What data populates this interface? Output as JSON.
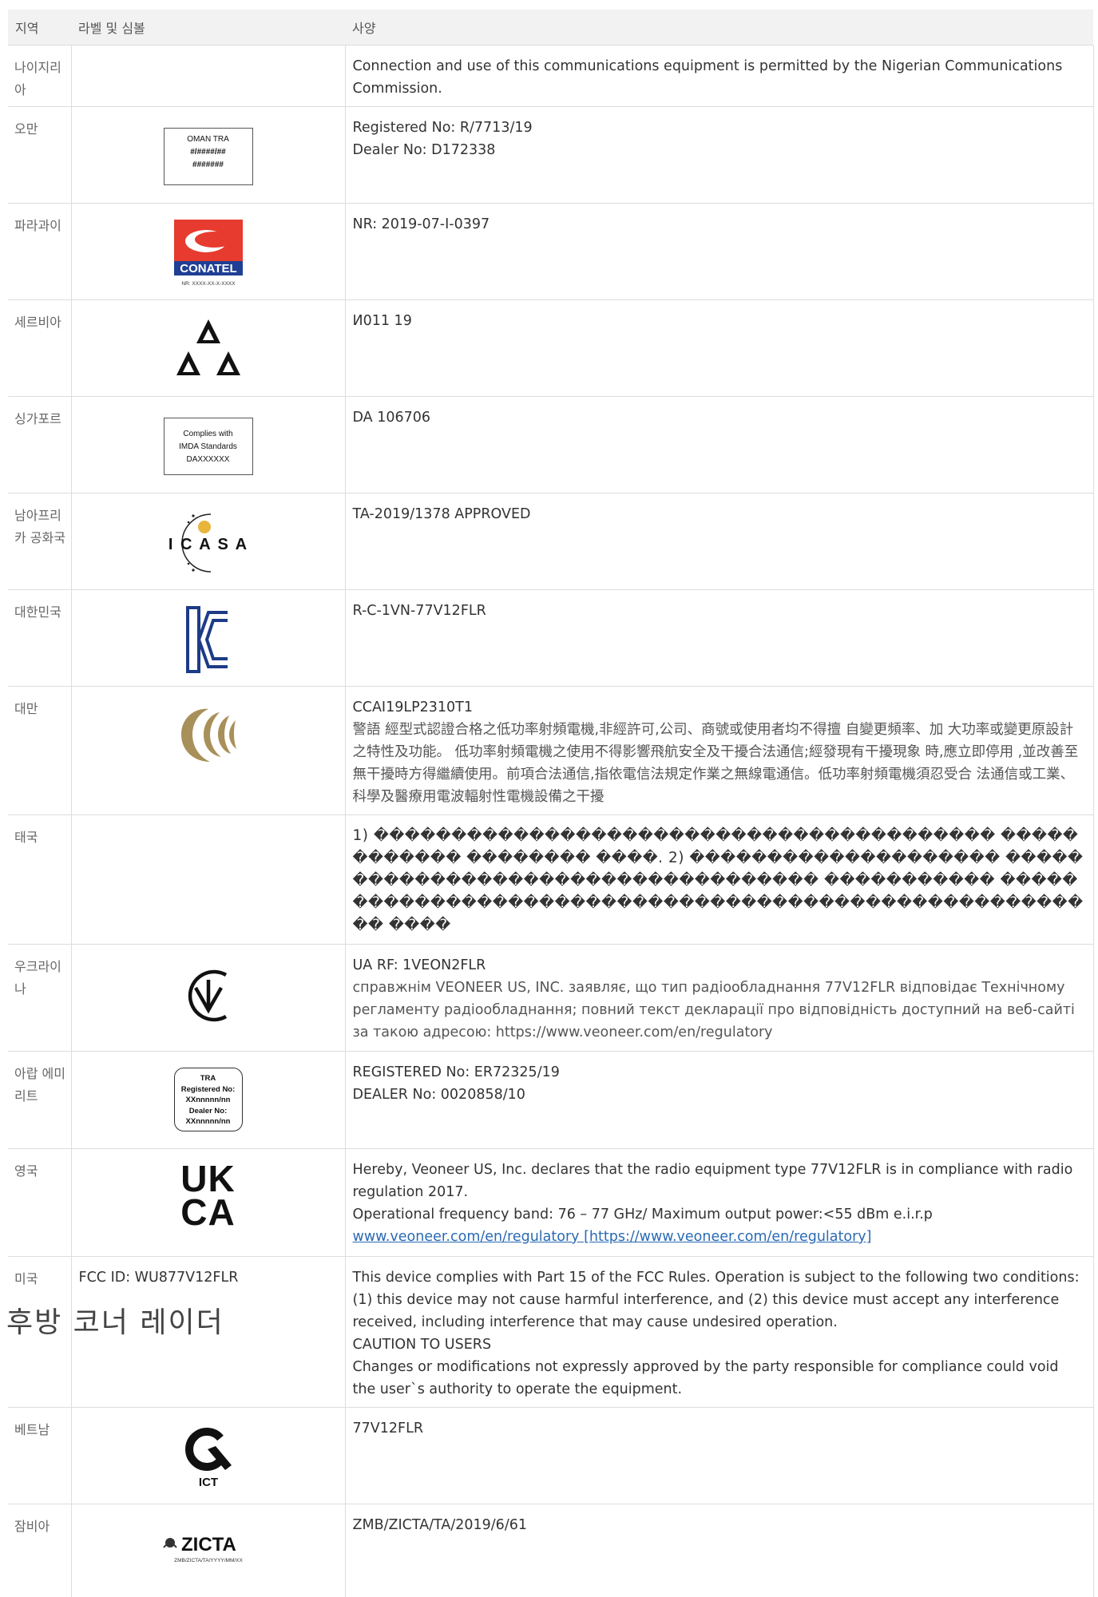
{
  "headers": {
    "region": "지역",
    "label": "라벨 및 심볼",
    "spec": "사양"
  },
  "overlay_title": "후방 코너 레이더",
  "rows": {
    "nigeria": {
      "region": "나이지리아",
      "spec": [
        "Connection and use of this communications equipment is permitted by the Nigerian Communications Commission."
      ]
    },
    "oman": {
      "region": "오만",
      "logo_text": [
        "OMAN TRA",
        "#/####/##",
        "#######"
      ],
      "spec": [
        "Registered No: R/7713/19",
        "Dealer No: D172338"
      ]
    },
    "paraguay": {
      "region": "파라과이",
      "logo_text": [
        "CONATEL",
        "NR: XXXX-XX-X-XXXX"
      ],
      "spec": [
        "NR: 2019-07-I-0397"
      ]
    },
    "serbia": {
      "region": "세르비아",
      "spec": [
        "И011 19"
      ]
    },
    "singapore": {
      "region": "싱가포르",
      "logo_text": [
        "Complies with",
        "IMDA Standards",
        "DAXXXXXX"
      ],
      "spec": [
        "DA 106706"
      ]
    },
    "south_africa": {
      "region": "남아프리카 공화국",
      "logo_text": [
        "I C A S A"
      ],
      "spec": [
        "TA-2019/1378 APPROVED"
      ]
    },
    "korea": {
      "region": "대한민국",
      "spec": [
        "R-C-1VN-77V12FLR"
      ]
    },
    "taiwan": {
      "region": "대만",
      "spec": [
        "CCAI19LP2310T1",
        "警語 經型式認證合格之低功率射頻電機,非經許可,公司、商號或使用者均不得擅 自變更頻率、加 大功率或變更原設計之特性及功能。 低功率射頻電機之使用不得影響飛航安全及干擾合法通信;經發現有干擾現象 時,應立即停用 ,並改善至無干擾時方得繼續使用。前項合法通信,指依電信法規定作業之無線電通信。低功率射頻電機須忍受合 法通信或工業、科學及醫療用電波輻射性電機設備之干擾"
      ]
    },
    "thailand": {
      "region": "태국",
      "spec": [
        "1) ���������������������������������������� ������������ �������� ����. 2) �������������������� ����������������������������������� ����������� ������������������������������������������������������ ����"
      ]
    },
    "ukraine": {
      "region": "우크라이나",
      "spec": [
        "UA RF: 1VEON2FLR",
        "справжнім VEONEER US, INC. заявляє, що тип радіообладнання 77V12FLR відповідає Технічному регламенту радіообладнання; повний текст декларації про відповідність доступний на веб-сайті за такою адресою: https://www.veoneer.com/en/regulatory"
      ]
    },
    "uae": {
      "region": "아랍 에미리트",
      "logo_text": [
        "TRA",
        "Registered No:",
        "XXnnnnn/nn",
        "Dealer No:",
        "XXnnnnn/nn"
      ],
      "spec": [
        "REGISTERED No: ER72325/19",
        "DEALER No: 0020858/10"
      ]
    },
    "uk": {
      "region": "영국",
      "logo_text": [
        "UK",
        "CA"
      ],
      "spec": [
        "Hereby, Veoneer US, Inc. declares that the radio equipment type 77V12FLR is in compliance with radio regulation 2017.",
        "Operational frequency band: 76 – 77 GHz/ Maximum output power:<55 dBm e.i.r.p"
      ],
      "link_text": "www.veoneer.com/en/regulatory [https://www.veoneer.com/en/regulatory]"
    },
    "usa": {
      "region": "미국",
      "label_text": "FCC ID: WU877V12FLR",
      "spec": [
        "This device complies with Part 15 of the FCC Rules. Operation is subject to the following two conditions: (1) this device may not cause harmful interference, and (2) this device must accept any interference received, including interference that may cause undesired operation.",
        "CAUTION TO USERS",
        "Changes or modifications not expressly approved by the party responsible for compliance could void the user`s authority to operate the equipment."
      ]
    },
    "vietnam": {
      "region": "베트남",
      "logo_text": [
        "ICT"
      ],
      "spec": [
        "77V12FLR"
      ]
    },
    "zambia": {
      "region": "잠비아",
      "logo_text": [
        "ZICTA",
        "ZMB/ZICTA/TA/YYYY/MM/XX"
      ],
      "spec": [
        "ZMB/ZICTA/TA/2019/6/61"
      ]
    }
  },
  "colors": {
    "conatel_red": "#e63b2e",
    "conatel_blue": "#1f3f95",
    "kc_blue": "#1d3b86",
    "taiwan_gold": "#a8905a",
    "link_blue": "#2a6ab3"
  }
}
